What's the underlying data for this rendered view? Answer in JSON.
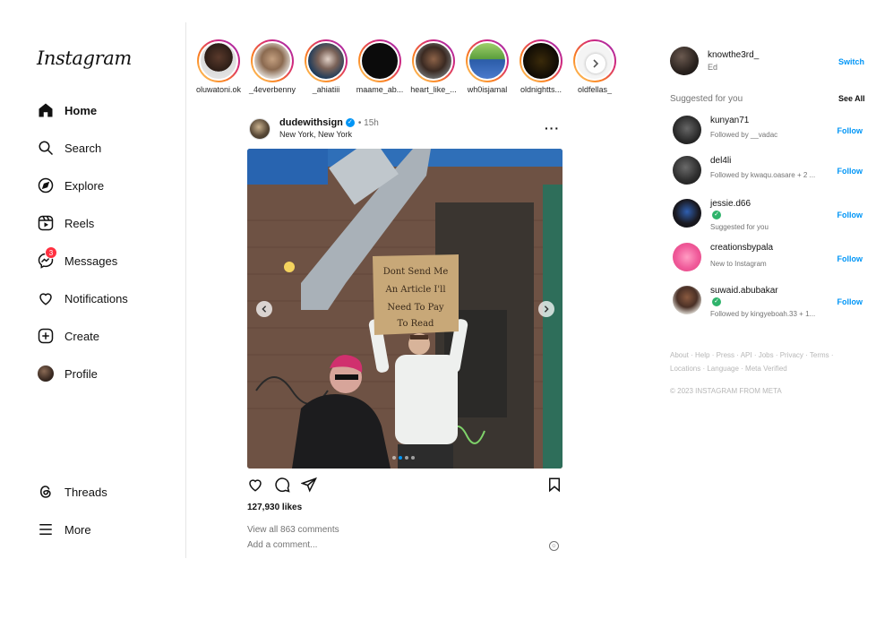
{
  "brand": {
    "logo_text": "Instagram"
  },
  "sidebar": {
    "items": [
      {
        "label": "Home",
        "icon": "home-icon"
      },
      {
        "label": "Search",
        "icon": "search-icon"
      },
      {
        "label": "Explore",
        "icon": "explore-icon"
      },
      {
        "label": "Reels",
        "icon": "reels-icon"
      },
      {
        "label": "Messages",
        "icon": "messages-icon",
        "badge": "3"
      },
      {
        "label": "Notifications",
        "icon": "heart-icon"
      },
      {
        "label": "Create",
        "icon": "plus-square-icon"
      },
      {
        "label": "Profile",
        "icon": "avatar"
      }
    ],
    "bottom_items": [
      {
        "label": "Threads",
        "icon": "threads-icon"
      },
      {
        "label": "More",
        "icon": "menu-icon"
      }
    ]
  },
  "stories": [
    {
      "name": "oluwatoni.ok"
    },
    {
      "name": "_4everbenny"
    },
    {
      "name": "_ahiatiii"
    },
    {
      "name": "maame_ab..."
    },
    {
      "name": "heart_like_..."
    },
    {
      "name": "wh0isjamal"
    },
    {
      "name": "oldnightts..."
    },
    {
      "name": "oldfellas_"
    }
  ],
  "post": {
    "username": "dudewithsign",
    "time": "• 15h",
    "location": "New York, New York",
    "sign_text": "Dont Send Me An Article I'll Need To Pay To Read",
    "likes": "127,930 likes",
    "view_comments": "View all 863 comments",
    "comment_placeholder": "Add a comment..."
  },
  "account": {
    "username": "knowthe3rd_",
    "full_name": "Ed",
    "switch_label": "Switch"
  },
  "suggestions": {
    "title": "Suggested for you",
    "see_all": "See All",
    "follow_label": "Follow",
    "items": [
      {
        "username": "kunyan71",
        "subtitle": "Followed by __vadac"
      },
      {
        "username": "del4li",
        "subtitle": "Followed by kwaqu.oasare + 2 ..."
      },
      {
        "username": "jessie.d66",
        "subtitle": "Suggested for you"
      },
      {
        "username": "creationsbypala",
        "subtitle": "New to Instagram"
      },
      {
        "username": "suwaid.abubakar",
        "subtitle": "Followed by kingyeboah.33 + 1..."
      }
    ]
  },
  "footer": {
    "links_line1": "About · Help · Press · API · Jobs · Privacy · Terms ·",
    "links_line2": "Locations · Language · Meta Verified",
    "copyright": "© 2023 INSTAGRAM FROM META"
  },
  "colors": {
    "accent": "#0095f6",
    "badge": "#ff3040",
    "verified_check": "#2fb36b"
  }
}
